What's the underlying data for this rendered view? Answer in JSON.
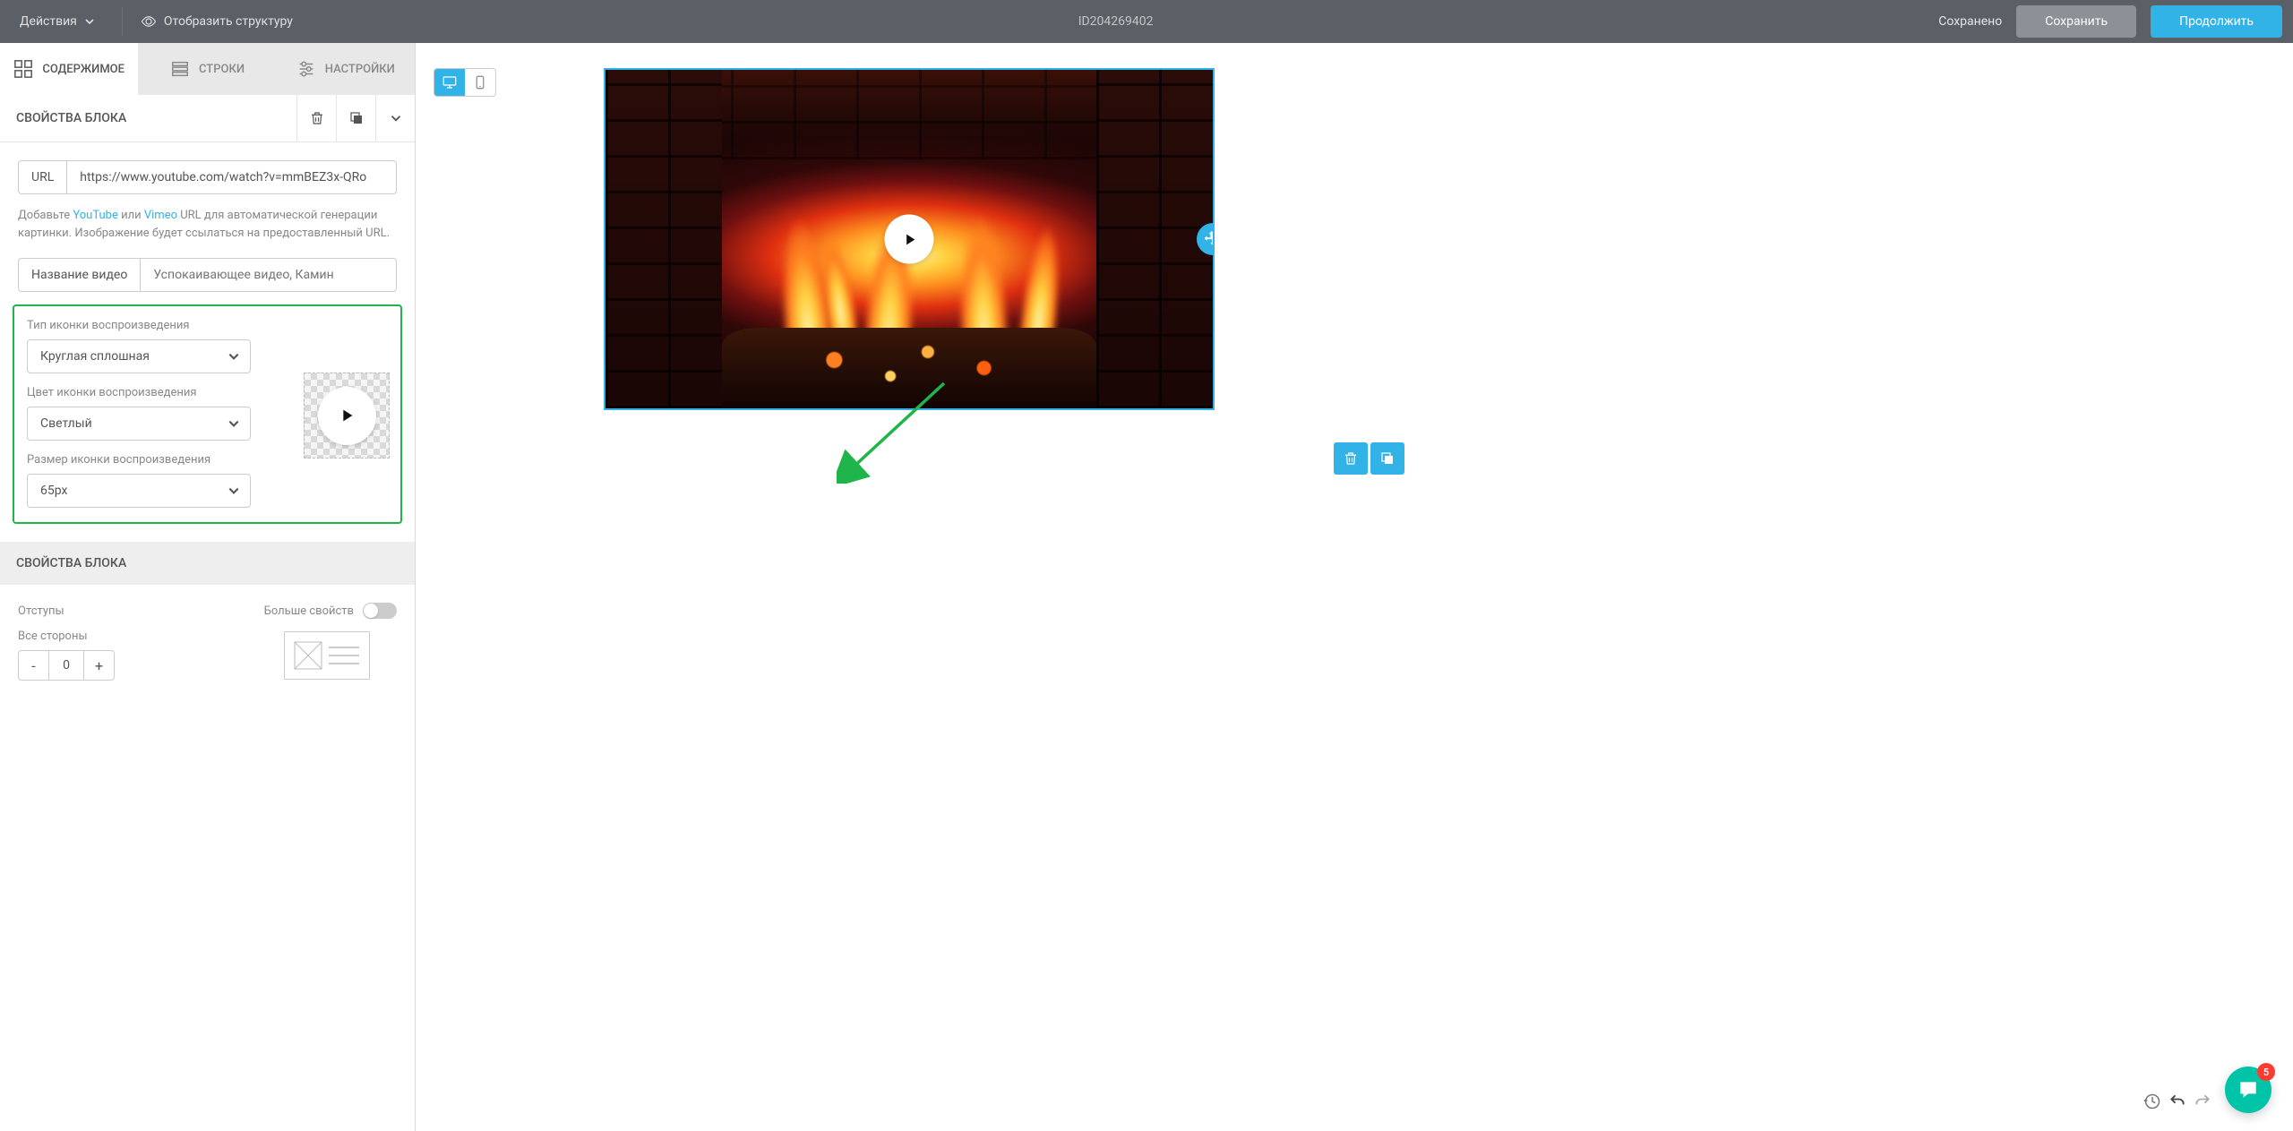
{
  "header": {
    "actions": "Действия",
    "show_structure": "Отобразить структуру",
    "doc_id": "ID204269402",
    "saved": "Сохранено",
    "save_btn": "Сохранить",
    "continue_btn": "Продолжить"
  },
  "tabs": {
    "content": "СОДЕРЖИМОЕ",
    "rows": "СТРОКИ",
    "settings": "НАСТРОЙКИ"
  },
  "panel": {
    "title": "СВОЙСТВА БЛОКА"
  },
  "url": {
    "label": "URL",
    "value": "https://www.youtube.com/watch?v=mmBEZ3x-QRo"
  },
  "help": {
    "prefix": "Добавьте ",
    "youtube": "YouTube",
    "mid": " или ",
    "vimeo": "Vimeo",
    "suffix": " URL для автоматической генерации картинки. Изображение будет ссылаться на предоставленный URL."
  },
  "video_title": {
    "label": "Название видео",
    "placeholder": "Успокаивающее видео, Камин"
  },
  "icon_type": {
    "label": "Тип иконки воспроизведения",
    "value": "Круглая сплошная"
  },
  "icon_color": {
    "label": "Цвет иконки воспроизведения",
    "value": "Светлый"
  },
  "icon_size": {
    "label": "Размер иконки воспроизведения",
    "value": "65px"
  },
  "section2": {
    "title": "СВОЙСТВА БЛОКА"
  },
  "padding": {
    "label": "Отступы",
    "more_props": "Больше свойств",
    "all_sides": "Все стороны",
    "value": "0"
  },
  "chat_badge": "5"
}
